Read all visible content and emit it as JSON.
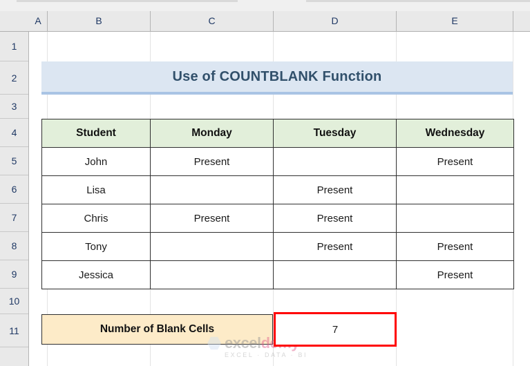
{
  "app": {
    "type": "spreadsheet",
    "columns": [
      "A",
      "B",
      "C",
      "D",
      "E"
    ],
    "rows": [
      "1",
      "2",
      "3",
      "4",
      "5",
      "6",
      "7",
      "8",
      "9",
      "10",
      "11"
    ]
  },
  "title_banner": {
    "text": "Use of COUNTBLANK Function",
    "fill_color": "#DCE6F2",
    "text_color": "#31506B",
    "range": "B2:E2"
  },
  "table": {
    "range": "B4:E9",
    "header_fill": "#E2EFDA",
    "headers": [
      "Student",
      "Monday",
      "Tuesday",
      "Wednesday"
    ],
    "rows": [
      {
        "student": "John",
        "monday": "Present",
        "tuesday": "",
        "wednesday": "Present"
      },
      {
        "student": "Lisa",
        "monday": "",
        "tuesday": "Present",
        "wednesday": ""
      },
      {
        "student": "Chris",
        "monday": "Present",
        "tuesday": "Present",
        "wednesday": ""
      },
      {
        "student": "Tony",
        "monday": "",
        "tuesday": "Present",
        "wednesday": "Present"
      },
      {
        "student": "Jessica",
        "monday": "",
        "tuesday": "",
        "wednesday": "Present"
      }
    ]
  },
  "result": {
    "label": "Number of Blank Cells",
    "label_fill": "#FDEBC8",
    "value": "7",
    "highlight_color": "#FF0000",
    "label_range": "B11:C11",
    "value_range": "D11"
  },
  "watermark": {
    "brand_first": "excel",
    "brand_second": "demy",
    "tagline": "EXCEL · DATA · BI"
  }
}
